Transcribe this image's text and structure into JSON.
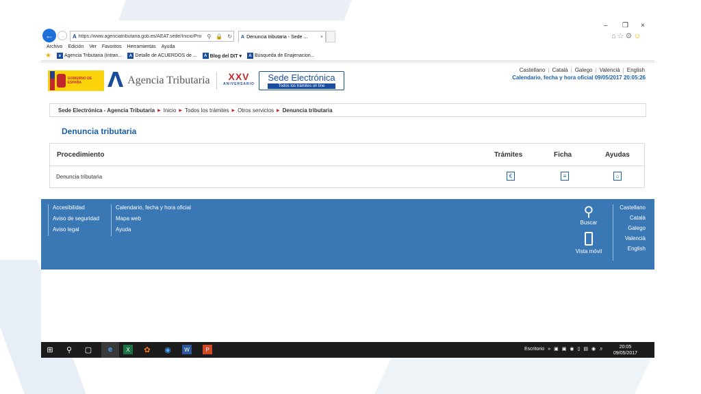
{
  "browser": {
    "url": "https://www.agenciatributaria.gob.es/AEAT.sede/Inicio/Pro",
    "tab_title": "Denuncia tributaria - Sede ...",
    "menu": [
      "Archivo",
      "Edición",
      "Ver",
      "Favoritos",
      "Herramientas",
      "Ayuda"
    ],
    "favorites": [
      {
        "label": "Agencia Tributaria (Intran...",
        "bold": false
      },
      {
        "label": "Detalle de ACUERDOS de ...",
        "bold": false
      },
      {
        "label": "Blog del DIT ▾",
        "bold": true
      },
      {
        "label": "Búsqueda de Enajenacion...",
        "bold": false
      }
    ]
  },
  "header": {
    "gobierno": "GOBIERNO DE ESPAÑA",
    "agency_name": "Agencia Tributaria",
    "aniversario_num": "XXV",
    "aniversario_label": "ANIVERSARIO",
    "sede_title": "Sede Electrónica",
    "sede_subtitle": "Todos los trámites on line",
    "languages": [
      "Castellano",
      "Català",
      "Galego",
      "Valencià",
      "English"
    ],
    "calendar": "Calendario, fecha y hora oficial 09/05/2017 20:05:26"
  },
  "breadcrumb": {
    "root": "Sede Electrónica - Agencia Tributaria",
    "items": [
      "Inicio",
      "Todos los trámites",
      "Otros servicios"
    ],
    "current": "Denuncia tributaria"
  },
  "page_title": "Denuncia tributaria",
  "table": {
    "headers": {
      "procedimiento": "Procedimiento",
      "tramites": "Trámites",
      "ficha": "Ficha",
      "ayudas": "Ayudas"
    },
    "rows": [
      {
        "procedimiento": "Denuncia tributaria"
      }
    ]
  },
  "footer": {
    "col1": [
      "Accesibilidad",
      "Aviso de seguridad",
      "Aviso legal"
    ],
    "col2": [
      "Calendario, fecha y hora oficial",
      "Mapa web",
      "Ayuda"
    ],
    "search": "Buscar",
    "mobile": "Vista móvil",
    "languages": [
      "Castellano",
      "Català",
      "Galego",
      "Valencià",
      "English"
    ]
  },
  "taskbar": {
    "desktop": "Escritorio",
    "time": "20:05",
    "date": "09/05/2017"
  }
}
